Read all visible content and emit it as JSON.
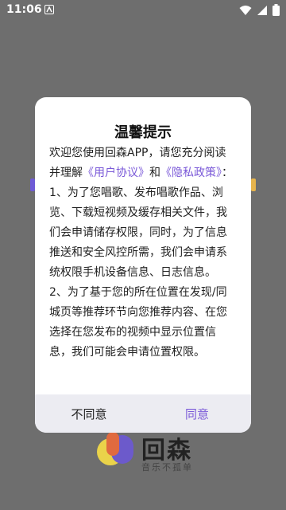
{
  "status_bar": {
    "time": "11:06"
  },
  "background_brand": {
    "logo_text": "回森",
    "slogan": "音乐不孤单"
  },
  "dialog": {
    "title": "温馨提示",
    "intro_prefix": "欢迎您使用回森APP，请您充分阅读并理解",
    "user_agreement_link": "《用户协议》",
    "and_text": "和",
    "privacy_policy_link": "《隐私政策》",
    "colon": "：",
    "item1": "1、为了您唱歌、发布唱歌作品、浏览、下载短视频及缓存相关文件，我们会申请储存权限，同时，为了信息推送和安全风控所需，我们会申请系统权限手机设备信息、日志信息。",
    "item2": "2、为了基于您的所在位置在发现/同城页等推荐环节向您推荐内容、在您选择在您发布的视频中显示位置信息，我们可能会申请位置权限。",
    "disagree_button": "不同意",
    "agree_button": "同意"
  },
  "colors": {
    "overlay": "#6e6e6e",
    "link": "#7a59d8",
    "button_bar": "#ececf2"
  }
}
